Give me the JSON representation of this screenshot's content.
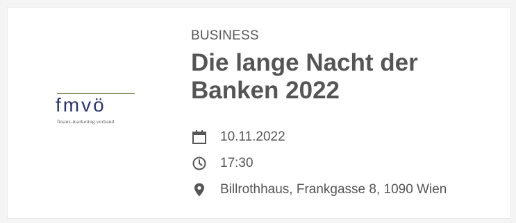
{
  "card": {
    "logo": {
      "name": "fmvö",
      "subtitle": "finanz-marketing verband"
    },
    "category": "BUSINESS",
    "title_line1": "Die lange Nacht der",
    "title_line2": "Banken 2022",
    "meta": {
      "date": {
        "icon": "calendar-icon",
        "text": "10.11.2022"
      },
      "time": {
        "icon": "clock-icon",
        "text": "17:30"
      },
      "location": {
        "icon": "location-pin-icon",
        "text": "Billrothhaus, Frankgasse 8, 1090 Wien"
      }
    }
  },
  "colors": {
    "text": "#555555",
    "logo_blue": "#2b3572",
    "logo_line": "#8d9a6a",
    "card_bg": "#ffffff",
    "page_bg": "#f4f4f4"
  }
}
